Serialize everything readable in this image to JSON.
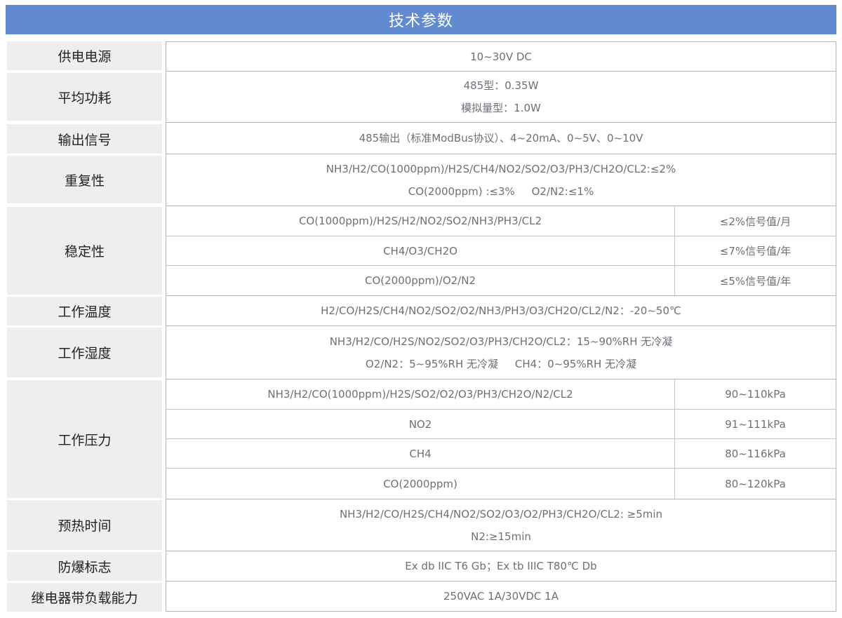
{
  "title": "技术参数",
  "rows": [
    {
      "label": "供电电源",
      "lines": [
        "10~30V DC"
      ]
    },
    {
      "label": "平均功耗",
      "lines": [
        "485型：0.35W",
        "模拟量型：1.0W"
      ]
    },
    {
      "label": "输出信号",
      "lines": [
        "485输出（标准ModBus协议）、4~20mA、0~5V、0~10V"
      ]
    },
    {
      "label": "重复性",
      "lines": [
        "NH3/H2/CO(1000ppm)/H2S/CH4/NO2/SO2/O3/PH3/CH2O/CL2:≤2%",
        "CO(2000ppm) :≤3%     O2/N2:≤1%"
      ]
    },
    {
      "label": "稳定性",
      "sub": [
        {
          "gases": "CO(1000ppm)/H2S/H2/NO2/SO2/NH3/PH3/CL2",
          "value": "≤2%信号值/月"
        },
        {
          "gases": "CH4/O3/CH2O",
          "value": "≤7%信号值/年"
        },
        {
          "gases": "CO(2000ppm)/O2/N2",
          "value": "≤5%信号值/年"
        }
      ]
    },
    {
      "label": "工作温度",
      "lines": [
        "H2/CO/H2S/CH4/NO2/SO2/O2/NH3/PH3/O3/CH2O/CL2/N2：-20~50℃"
      ]
    },
    {
      "label": "工作湿度",
      "lines": [
        "NH3/H2/CO/H2S/NO2/SO2/O3/PH3/CH2O/CL2：15~90%RH 无冷凝",
        "O2/N2：5~95%RH 无冷凝     CH4：0~95%RH 无冷凝"
      ]
    },
    {
      "label": "工作压力",
      "sub": [
        {
          "gases": "NH3/H2/CO(1000ppm)/H2S/SO2/O2/O3/PH3/CH2O/N2/CL2",
          "value": "90~110kPa"
        },
        {
          "gases": "NO2",
          "value": "91~111kPa"
        },
        {
          "gases": "CH4",
          "value": "80~116kPa"
        },
        {
          "gases": "CO(2000ppm)",
          "value": "80~120kPa"
        }
      ]
    },
    {
      "label": "预热时间",
      "lines": [
        "NH3/H2/CO/H2S/CH4/NO2/SO2/O3/O2/PH3/CH2O/CL2: ≥5min",
        "N2:≥15min"
      ]
    },
    {
      "label": "防爆标志",
      "lines": [
        "Ex db IIC T6 Gb；Ex tb IIIC T80℃ Db"
      ]
    },
    {
      "label": "继电器带负载能力",
      "lines": [
        "250VAC 1A/30VDC 1A"
      ]
    }
  ]
}
